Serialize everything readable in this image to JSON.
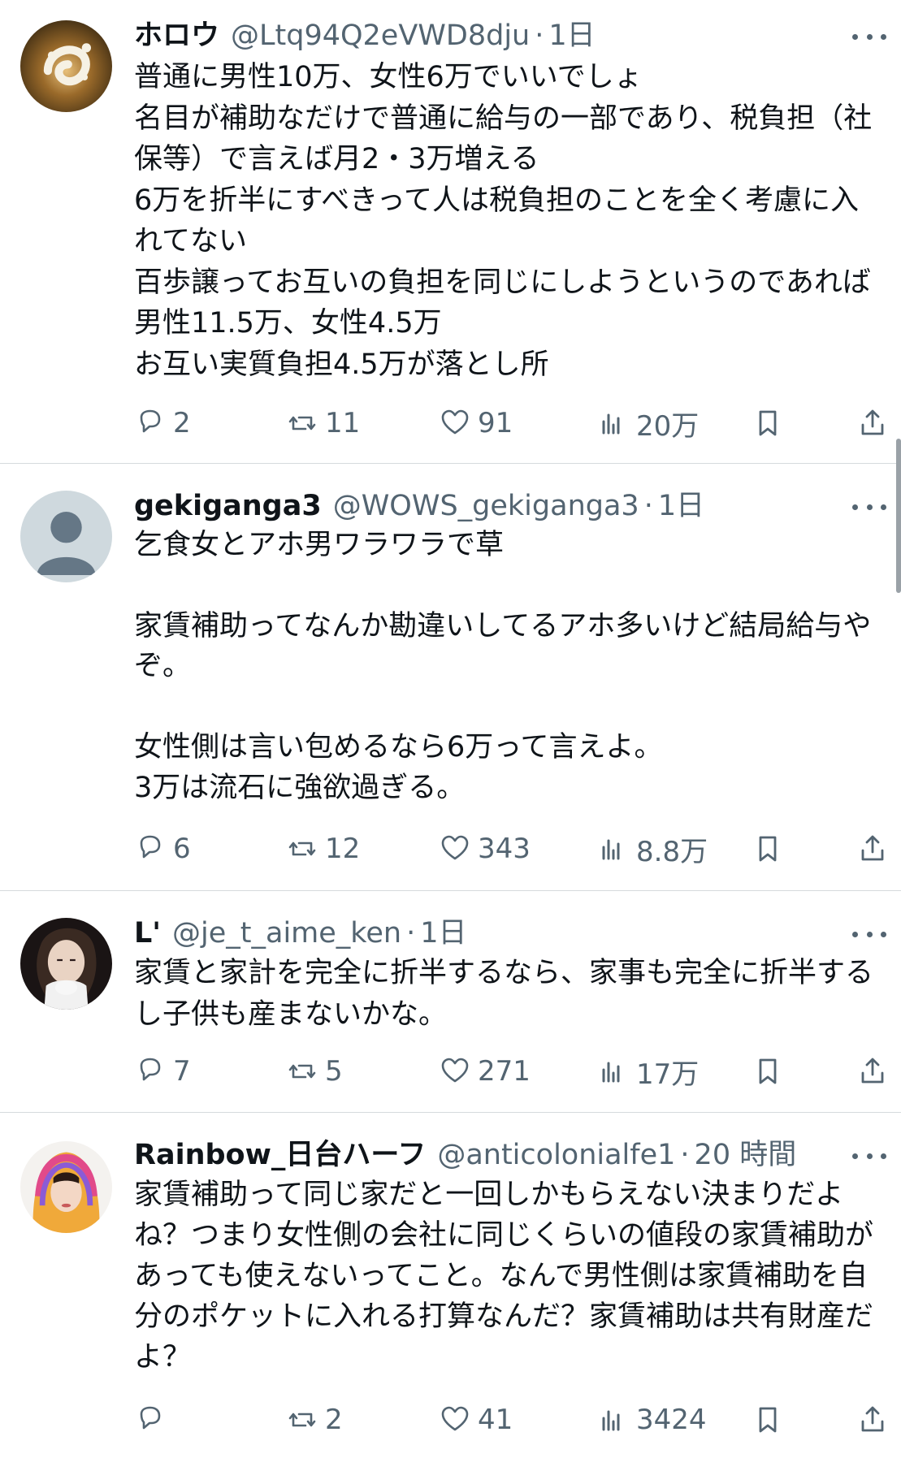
{
  "posts": [
    {
      "name": "ホロウ",
      "handle": "@Ltq94Q2eVWD8dju",
      "time": "1日",
      "text": "普通に男性10万、女性6万でいいでしょ\n名目が補助なだけで普通に給与の一部であり、税負担（社保等）で言えば月2・3万増える\n6万を折半にすべきって人は税負担のことを全く考慮に入れてない\n百歩譲ってお互いの負担を同じにしようというのであれば男性11.5万、女性4.5万\nお互い実質負担4.5万が落とし所",
      "replies": "2",
      "reposts": "11",
      "likes": "91",
      "views": "20万"
    },
    {
      "name": "gekiganga3",
      "handle": "@WOWS_gekiganga3",
      "time": "1日",
      "text": "乞食女とアホ男ワラワラで草\n\n家賃補助ってなんか勘違いしてるアホ多いけど結局給与やぞ。\n\n女性側は言い包めるなら6万って言えよ。\n3万は流石に強欲過ぎる。",
      "replies": "6",
      "reposts": "12",
      "likes": "343",
      "views": "8.8万"
    },
    {
      "name": "L'",
      "handle": "@je_t_aime_ken",
      "time": "1日",
      "text": "家賃と家計を完全に折半するなら、家事も完全に折半するし子供も産まないかな。",
      "replies": "7",
      "reposts": "5",
      "likes": "271",
      "views": "17万"
    },
    {
      "name": "Rainbow_日台ハーフ",
      "handle": "@anticolonialfe1",
      "time": "20 時間",
      "text": "家賃補助って同じ家だと一回しかもらえない決まりだよね？つまり女性側の会社に同じくらいの値段の家賃補助があっても使えないってこと。なんで男性側は家賃補助を自分のポケットに入れる打算なんだ？家賃補助は共有財産だよ？",
      "replies": "",
      "reposts": "2",
      "likes": "41",
      "views": "3424"
    }
  ],
  "icons": {
    "reply": "reply-icon",
    "repost": "repost-icon",
    "like": "like-icon",
    "views": "views-icon",
    "bookmark": "bookmark-icon",
    "share": "share-icon",
    "more": "more-icon"
  },
  "colors": {
    "text": "#0f1419",
    "secondary": "#536471",
    "divider": "#d6dadd"
  }
}
